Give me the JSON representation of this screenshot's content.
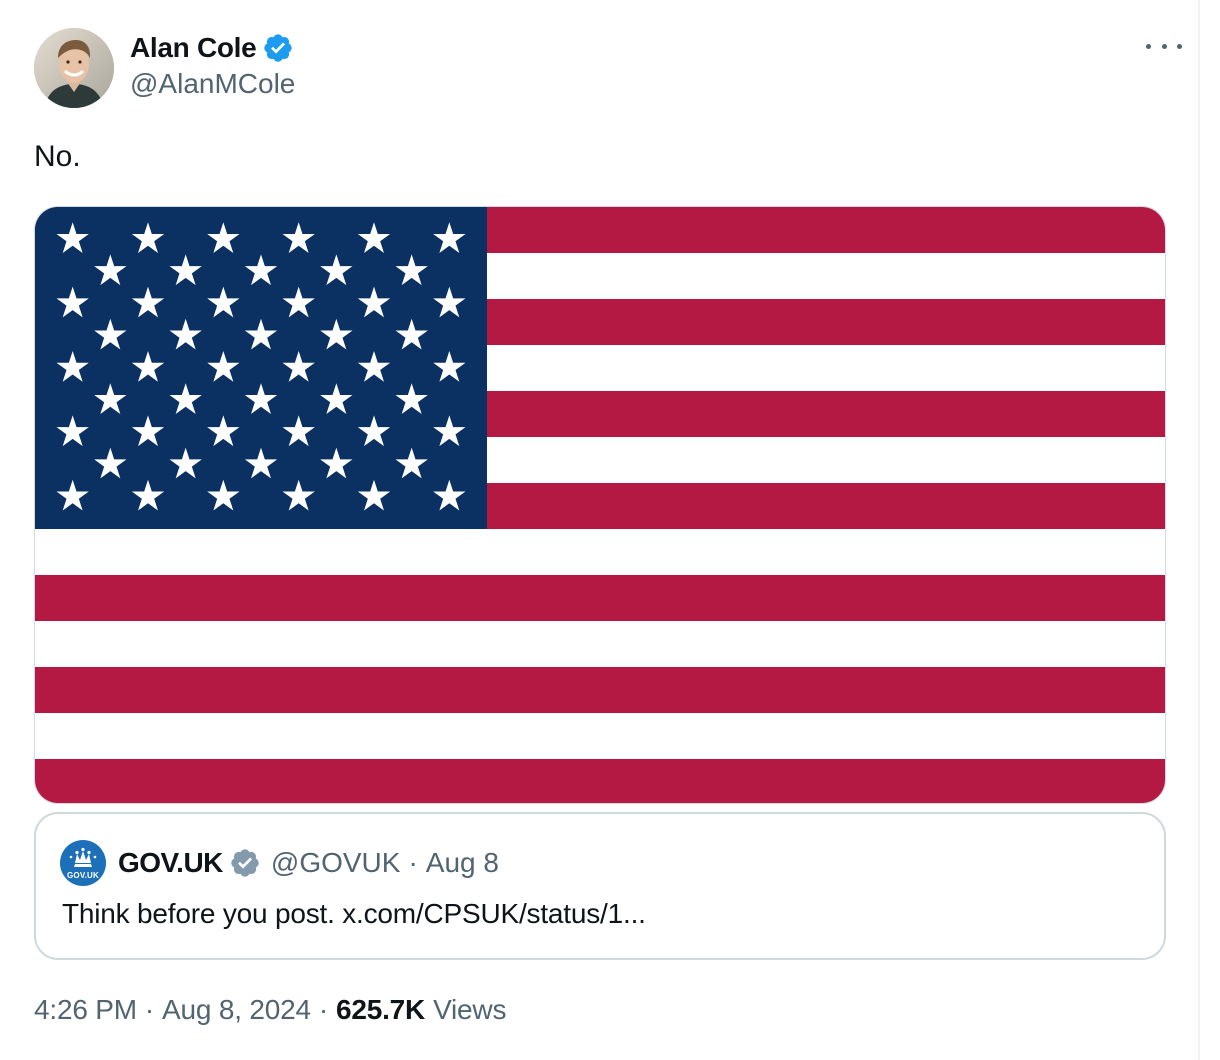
{
  "author": {
    "display_name": "Alan Cole",
    "handle": "@AlanMCole",
    "verified": true,
    "avatar_icon": "profile-photo"
  },
  "tweet": {
    "text": "No.",
    "media_description_icon": "us-flag-image"
  },
  "quoted_tweet": {
    "logo_text": "GOV.UK",
    "display_name": "GOV.UK",
    "verified_icon": "grey-verified-badge-icon",
    "handle": "@GOVUK",
    "separator": "·",
    "date": "Aug 8",
    "text": "Think before you post. x.com/CPSUK/status/1..."
  },
  "meta": {
    "time": "4:26 PM",
    "separator": "·",
    "date": "Aug 8, 2024",
    "views_count": "625.7K",
    "views_label": "Views"
  },
  "colors": {
    "verified_blue": "#1d9bf0",
    "verified_grey": "#829aab",
    "flag_red": "#b31942",
    "flag_blue": "#0a3161",
    "gov_blue": "#1d70b8",
    "secondary_text": "#536471"
  }
}
